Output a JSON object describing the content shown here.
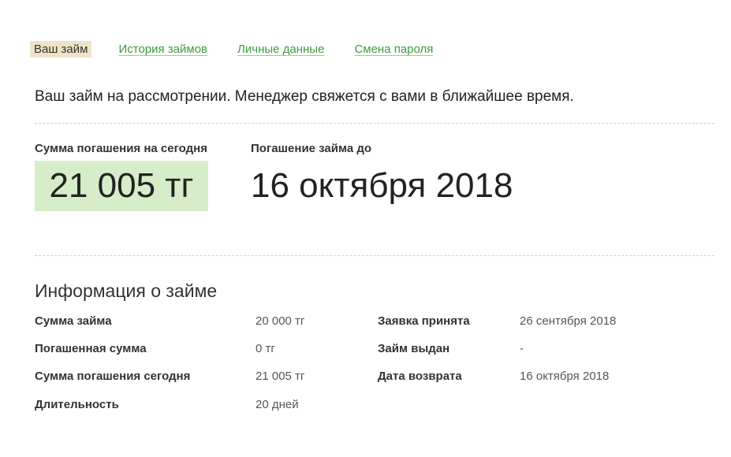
{
  "nav": {
    "items": [
      {
        "label": "Ваш займ",
        "active": true
      },
      {
        "label": "История займов",
        "active": false
      },
      {
        "label": "Личные данные",
        "active": false
      },
      {
        "label": "Смена пароля",
        "active": false
      }
    ]
  },
  "status_message": "Ваш займ на рассмотрении. Менеджер свяжется с вами в ближайшее время.",
  "summary": {
    "repay_today_label": "Сумма погашения на сегодня",
    "repay_today_value": "21 005 тг",
    "due_label": "Погашение займа до",
    "due_value": "16 октября 2018"
  },
  "info": {
    "title": "Информация о займе",
    "left": [
      {
        "label": "Сумма займа",
        "value": "20 000 тг"
      },
      {
        "label": "Погашенная сумма",
        "value": "0 тг"
      },
      {
        "label": "Сумма погашения сегодня",
        "value": "21 005 тг"
      },
      {
        "label": "Длительность",
        "value": "20 дней"
      }
    ],
    "right": [
      {
        "label": "Заявка принята",
        "value": "26 сентября 2018"
      },
      {
        "label": "Займ выдан",
        "value": "-"
      },
      {
        "label": "Дата возврата",
        "value": "16 октября 2018"
      }
    ]
  },
  "colors": {
    "link_green": "#3e9a3e",
    "active_tab_bg": "#efe3c7",
    "highlight_bg": "#d6edc9"
  }
}
